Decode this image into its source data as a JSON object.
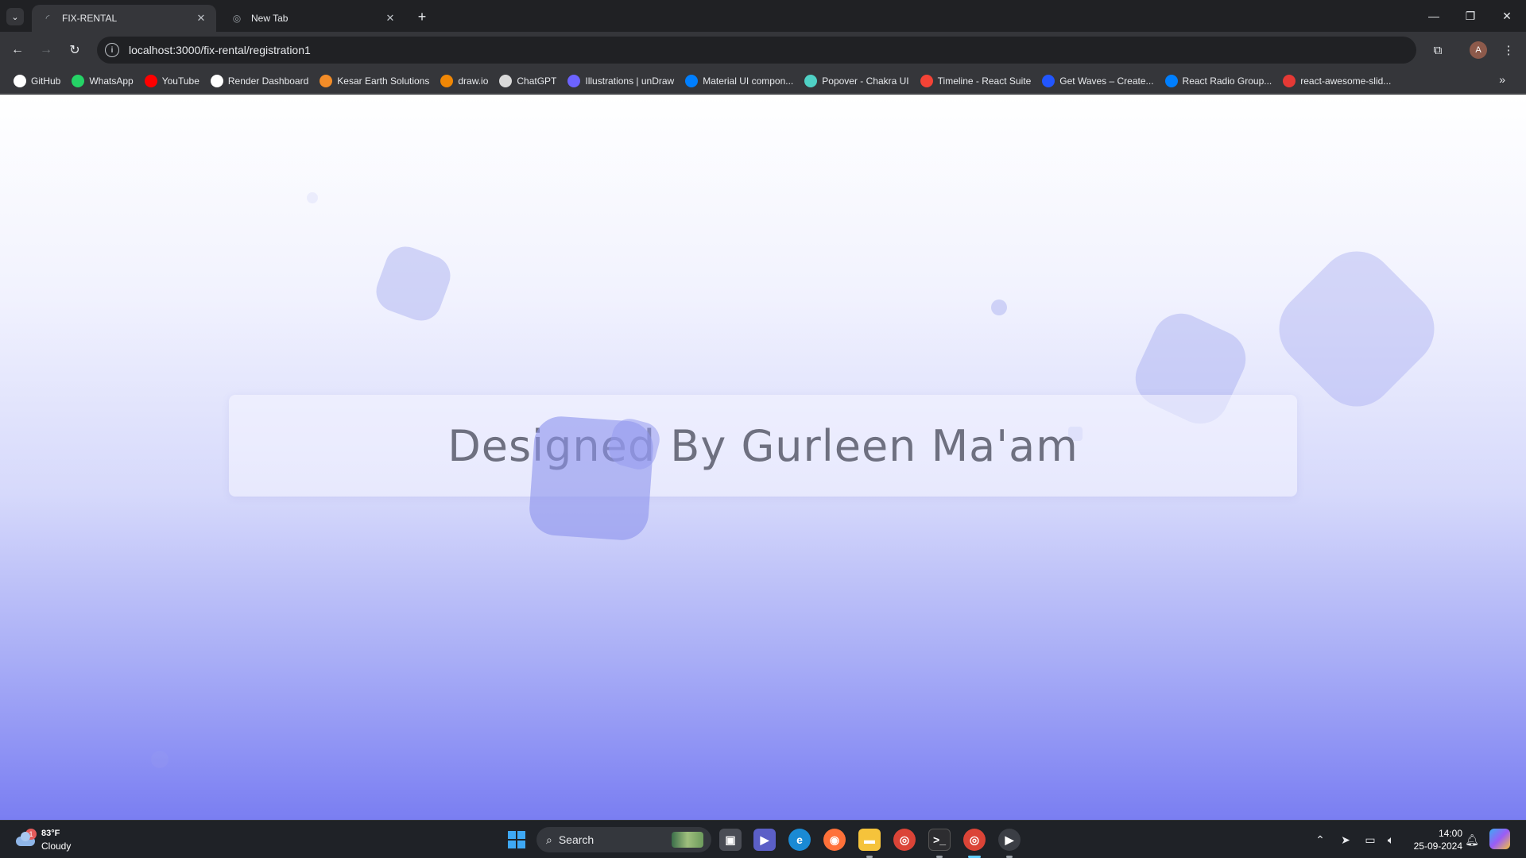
{
  "browser": {
    "tabs": [
      {
        "title": "FIX-RENTAL",
        "active": true
      },
      {
        "title": "New Tab",
        "active": false
      }
    ],
    "url": "localhost:3000/fix-rental/registration1",
    "profile_initial": "A",
    "bookmarks": [
      {
        "label": "GitHub",
        "icon": "github-icon",
        "color": "#ffffff"
      },
      {
        "label": "WhatsApp",
        "icon": "whatsapp-icon",
        "color": "#25d366"
      },
      {
        "label": "YouTube",
        "icon": "youtube-icon",
        "color": "#ff0000"
      },
      {
        "label": "Render Dashboard",
        "icon": "render-icon",
        "color": "#ffffff"
      },
      {
        "label": "Kesar Earth Solutions",
        "icon": "kesar-icon",
        "color": "#f28c28"
      },
      {
        "label": "draw.io",
        "icon": "drawio-icon",
        "color": "#f08705"
      },
      {
        "label": "ChatGPT",
        "icon": "chatgpt-icon",
        "color": "#d9d9d9"
      },
      {
        "label": "Illustrations | unDraw",
        "icon": "undraw-icon",
        "color": "#6c63ff"
      },
      {
        "label": "Material UI compon...",
        "icon": "mui-icon",
        "color": "#007fff"
      },
      {
        "label": "Popover - Chakra UI",
        "icon": "chakra-icon",
        "color": "#4fd1c5"
      },
      {
        "label": "Timeline - React Suite",
        "icon": "rsuite-icon",
        "color": "#f44336"
      },
      {
        "label": "Get Waves – Create...",
        "icon": "getwaves-icon",
        "color": "#2256ff"
      },
      {
        "label": "React Radio Group...",
        "icon": "mui-icon",
        "color": "#007fff"
      },
      {
        "label": "react-awesome-slid...",
        "icon": "awesome-slider-icon",
        "color": "#e53935"
      }
    ]
  },
  "page": {
    "banner_text": "Designed By Gurleen Ma'am",
    "gradient_colors": [
      "#ffffff",
      "#f1f2fe",
      "#d6d9fb",
      "#a8adf6",
      "#7a7ef2"
    ],
    "shape_color": "#a5aaf0"
  },
  "taskbar": {
    "weather": {
      "temp": "83°F",
      "condition": "Cloudy",
      "badge": "1"
    },
    "search_label": "Search",
    "time": "14:00",
    "date": "25-09-2024",
    "accent": "#60cdff"
  }
}
